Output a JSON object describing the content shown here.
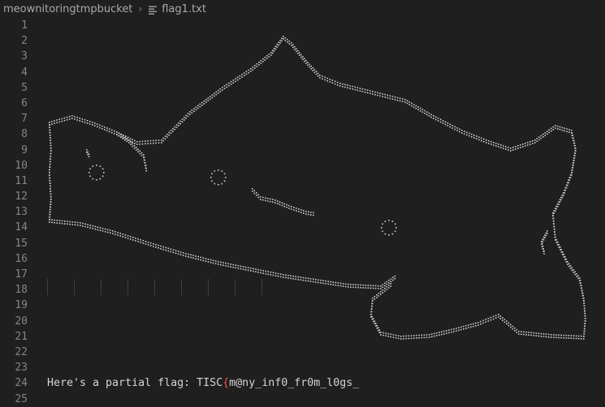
{
  "breadcrumb": {
    "folder": "meownitoringtmpbucket",
    "separator": "›",
    "file": "flag1.txt",
    "file_icon": "text-file-icon"
  },
  "editor": {
    "line_numbers": [
      "1",
      "2",
      "3",
      "4",
      "5",
      "6",
      "7",
      "8",
      "9",
      "10",
      "11",
      "12",
      "13",
      "14",
      "15",
      "16",
      "17",
      "18",
      "19",
      "20",
      "21",
      "22",
      "23",
      "24",
      "25"
    ],
    "flag_line": {
      "prefix": "Here's a partial flag: TISC",
      "brace": "{",
      "content": "m@ny_inf0_fr0m_l0gs_"
    },
    "ascii_art_name": "braille-cat-art",
    "colors": {
      "background": "#1f1f1f",
      "text": "#d4d4d4",
      "line_number": "#858585",
      "brace": "#f44747"
    }
  }
}
